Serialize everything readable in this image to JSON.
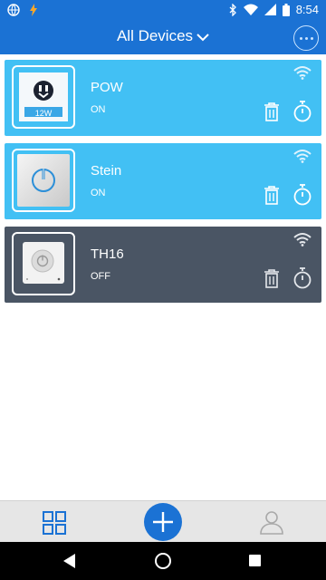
{
  "status_bar": {
    "time": "8:54",
    "icons": [
      "globe-icon",
      "flash-icon",
      "bluetooth-icon",
      "wifi-icon",
      "signal-icon",
      "battery-icon"
    ]
  },
  "app_bar": {
    "title": "All Devices",
    "dropdown_icon": "chevron-down-icon",
    "more_icon": "more-dots-icon",
    "color": "#1b72d4"
  },
  "devices": [
    {
      "name": "POW",
      "state": "ON",
      "badge": "12W",
      "icon": "outlet-icon",
      "color": "#42c0f4"
    },
    {
      "name": "Stein",
      "state": "ON",
      "icon": "power-switch-icon",
      "color": "#42c0f4"
    },
    {
      "name": "TH16",
      "state": "OFF",
      "icon": "power-switch-icon",
      "color": "#4a5564"
    }
  ],
  "bottom_bar": {
    "icons": [
      "grid-icon",
      "add-icon",
      "user-icon"
    ],
    "accent": "#1b72d4"
  },
  "nav_bar": {
    "icons": [
      "back-icon",
      "home-icon",
      "recents-icon"
    ]
  }
}
